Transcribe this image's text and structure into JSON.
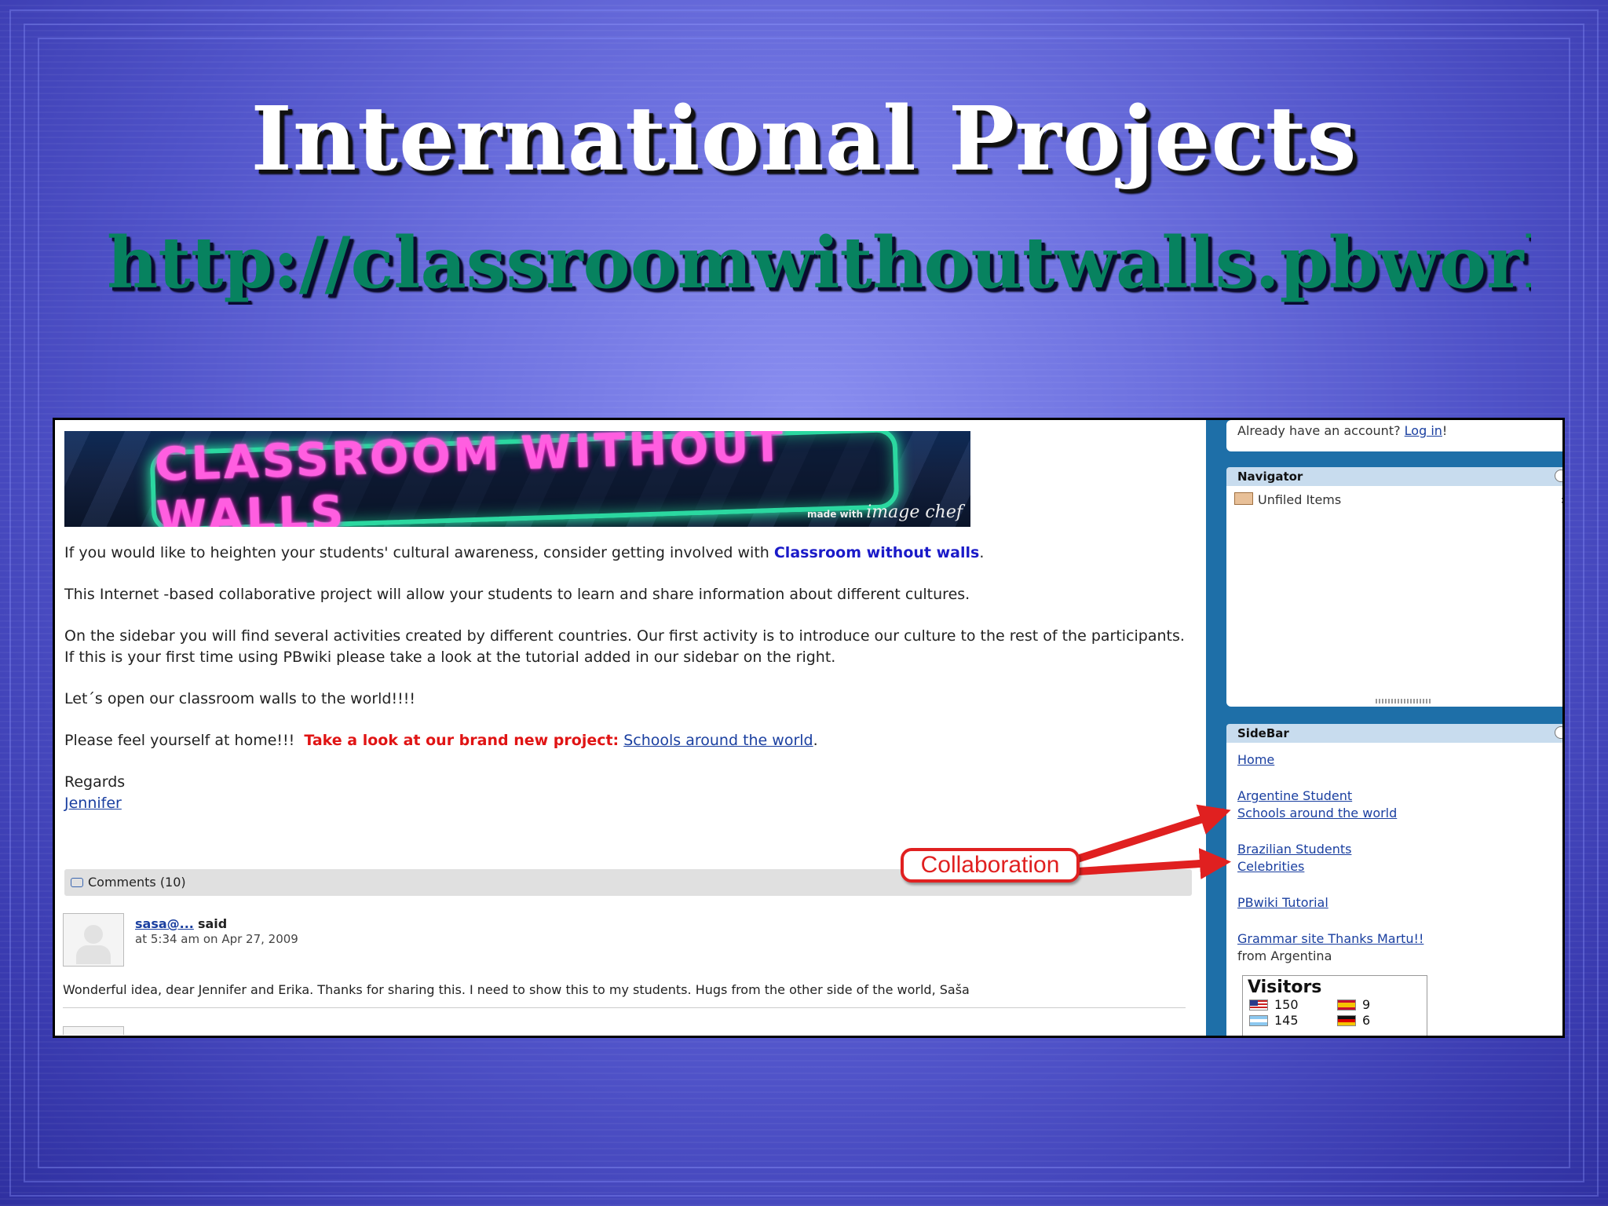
{
  "slide": {
    "title": "International Projects",
    "url": "http://classroomwithoutwalls.pbworks.com"
  },
  "banner": {
    "text": "CLASSROOM WITHOUT WALLS",
    "credit_prefix": "made with",
    "credit_brand": "image chef"
  },
  "content": {
    "p1_text": "If you would like to heighten your students' cultural awareness, consider getting involved with ",
    "p1_link": "Classroom without walls",
    "p1_end": ".",
    "p2": "This Internet -based collaborative project will allow your students to learn and share information about different cultures.",
    "p3": "On the sidebar you will find several activities created by different countries. Our first activity is to introduce our culture to the rest of the participants.",
    "p3b": "If this is your first time using PBwiki please take a look at the tutorial added in our sidebar on the right.",
    "p4": "Let´s open our classroom walls to the world!!!!",
    "p5_text": "Please feel yourself at home!!!  ",
    "p5_red": "Take a look at our brand new project:",
    "p5_link": "Schools around the world",
    "p5_end": ".",
    "regards": "Regards",
    "signature": "Jennifer"
  },
  "comments": {
    "header": "Comments (10)",
    "items": [
      {
        "author": "sasa@...",
        "said": "said",
        "date": "at 5:34 am on Apr 27, 2009",
        "text": "Wonderful idea, dear Jennifer and Erika. Thanks for sharing this. I need to show this to my students. Hugs from the other side of the world, Saša"
      }
    ]
  },
  "sidebar": {
    "account_text": "Already have an account? ",
    "login_link": "Log in",
    "login_end": "!",
    "navigator_title": "Navigator",
    "navigator_item": "Unfiled Items",
    "sidebar_title": "SideBar",
    "links": {
      "home": "Home",
      "argentine": "Argentine Student",
      "schools": "Schools around the world",
      "brazilian": "Brazilian Students",
      "celebrities": "Celebrities",
      "tutorial": "PBwiki Tutorial",
      "grammar": "Grammar site  Thanks Martu!!"
    },
    "from_argentina": "from Argentina",
    "visitors": {
      "title": "Visitors",
      "rows": [
        {
          "count": "150",
          "flag": "us-flag-icon"
        },
        {
          "count": "145",
          "flag": "argentina-flag-icon"
        },
        {
          "count": "9",
          "flag": "spain-flag-icon"
        },
        {
          "count": "6",
          "flag": "germany-flag-icon"
        }
      ]
    }
  },
  "annotation": {
    "label": "Collaboration",
    "color": "#e02020"
  }
}
